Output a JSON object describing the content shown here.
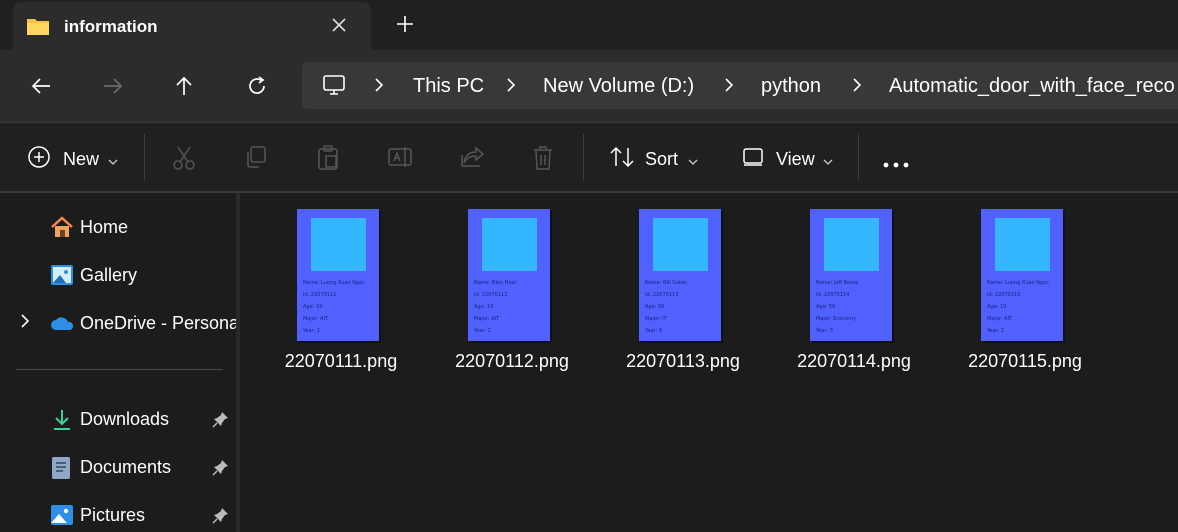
{
  "tab": {
    "title": "information",
    "folder_icon": "folder-icon",
    "close_icon": "close-icon",
    "new_tab_icon": "plus-icon"
  },
  "nav": {
    "back_icon": "arrow-left-icon",
    "forward_icon": "arrow-right-icon",
    "up_icon": "arrow-up-icon",
    "refresh_icon": "refresh-icon"
  },
  "address": {
    "pc_icon": "monitor-icon",
    "crumbs": [
      "This PC",
      "New Volume (D:)",
      "python",
      "Automatic_door_with_face_reco"
    ]
  },
  "toolbar": {
    "new_label": "New",
    "sort_label": "Sort",
    "view_label": "View",
    "icons": [
      "cut-icon",
      "copy-icon",
      "paste-icon",
      "rename-icon",
      "share-icon",
      "delete-icon",
      "more-icon"
    ]
  },
  "sidebar": {
    "items": [
      {
        "label": "Home",
        "icon": "home-icon"
      },
      {
        "label": "Gallery",
        "icon": "gallery-icon"
      },
      {
        "label": "OneDrive - Persona",
        "icon": "onedrive-icon"
      },
      {
        "label": "Downloads",
        "icon": "download-icon",
        "pinned": true
      },
      {
        "label": "Documents",
        "icon": "documents-icon",
        "pinned": true
      },
      {
        "label": "Pictures",
        "icon": "pictures-icon",
        "pinned": true
      }
    ]
  },
  "files": [
    {
      "name": "22070111.png",
      "card": [
        "Name: Luong Xuan Ngoc",
        "Id: 22070111",
        "Age: 19",
        "Major: AIT",
        "Year: 2"
      ]
    },
    {
      "name": "22070112.png",
      "card": [
        "Name: Bien Hoai",
        "Id: 22070112",
        "Age: 19",
        "Major: AIT",
        "Year: 2"
      ]
    },
    {
      "name": "22070113.png",
      "card": [
        "Name: Bill Gates",
        "Id: 22070113",
        "Age: 50",
        "Major: IT",
        "Year: 3"
      ]
    },
    {
      "name": "22070114.png",
      "card": [
        "Name: Jeff Bezos",
        "Id: 22070114",
        "Age: 50",
        "Major: Economy",
        "Year: 3"
      ]
    },
    {
      "name": "22070115.png",
      "card": [
        "Name: Luong Xuan Ngoc",
        "Id: 22070115",
        "Age: 19",
        "Major: AIT",
        "Year: 2"
      ]
    }
  ],
  "colors": {
    "card_bg": "#5061ff",
    "photo": "#35b7ff",
    "accent": "#4cc2ff"
  }
}
